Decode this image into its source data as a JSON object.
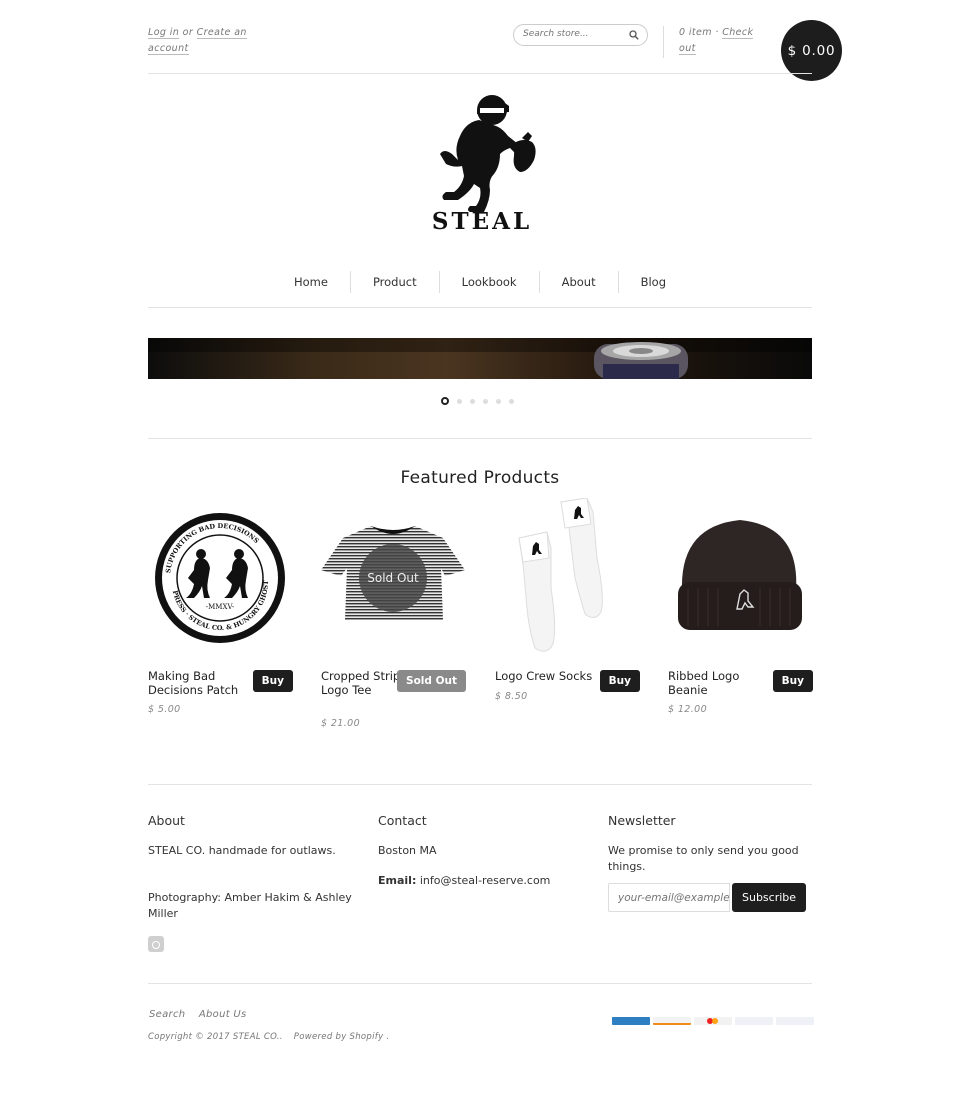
{
  "header": {
    "login": "Log in",
    "or": "or",
    "create_account": "Create an account",
    "search_placeholder": "Search store...",
    "cart_items": "0 item",
    "cart_dot": "·",
    "checkout": "Check out",
    "cart_total": "$ 0.00"
  },
  "nav": {
    "items": [
      "Home",
      "Product",
      "Lookbook",
      "About",
      "Blog"
    ]
  },
  "slideshow": {
    "active_index": 0,
    "count": 6
  },
  "featured": {
    "title": "Featured Products",
    "products": [
      {
        "name": "Making Bad Decisions Patch",
        "price": "$ 5.00",
        "button": "Buy"
      },
      {
        "name": "Cropped Striped Logo Tee",
        "price": "$ 21.00",
        "button": "Sold Out",
        "overlay": "Sold Out"
      },
      {
        "name": "Logo Crew Socks",
        "price": "$ 8.50",
        "button": "Buy"
      },
      {
        "name": "Ribbed Logo Beanie",
        "price": "$ 12.00",
        "button": "Buy"
      }
    ]
  },
  "footer": {
    "about": {
      "heading": "About",
      "line1": "STEAL CO. handmade for outlaws.",
      "line2": "Photography: Amber Hakim & Ashley Miller"
    },
    "contact": {
      "heading": "Contact",
      "city": "Boston MA",
      "email_label": "Email:",
      "email": "info@steal-reserve.com"
    },
    "newsletter": {
      "heading": "Newsletter",
      "text": "We promise to only send you good things.",
      "placeholder": "your-email@example.com",
      "button": "Subscribe"
    },
    "links": [
      "Search",
      "About Us"
    ],
    "copyright": "Copyright © 2017 STEAL CO..",
    "powered": "Powered by Shopify .",
    "payment_icons": [
      "american-express",
      "discover",
      "mastercard",
      "paypal",
      "visa"
    ]
  },
  "logo_text": "STEAL"
}
